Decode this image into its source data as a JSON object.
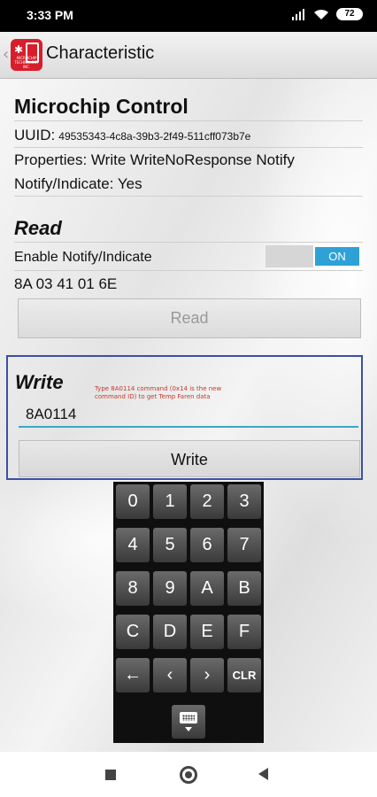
{
  "status": {
    "time": "3:33 PM",
    "battery": "72"
  },
  "appbar": {
    "title": "Characteristic"
  },
  "details": {
    "title": "Microchip Control",
    "uuid_label": "UUID:",
    "uuid_value": "49535343-4c8a-39b3-2f49-511cff073b7e",
    "properties": "Properties: Write WriteNoResponse Notify",
    "notify": "Notify/Indicate: Yes"
  },
  "read": {
    "heading": "Read",
    "enable_label": "Enable Notify/Indicate",
    "toggle_label": "ON",
    "value": "8A 03 41 01 6E",
    "button_label": "Read"
  },
  "write": {
    "heading": "Write",
    "annotation": "Type 8A0114 command (0x14 is the new command ID) to get Temp Faren data",
    "input_value": "8A0114",
    "button_label": "Write"
  },
  "keypad": {
    "rows": [
      [
        "0",
        "1",
        "2",
        "3"
      ],
      [
        "4",
        "5",
        "6",
        "7"
      ],
      [
        "8",
        "9",
        "A",
        "B"
      ],
      [
        "C",
        "D",
        "E",
        "F"
      ],
      [
        "←",
        "‹",
        "›",
        "CLR"
      ]
    ]
  },
  "colors": {
    "accent": "#2ea2d7",
    "annotation_box": "#3b4fa6",
    "annotation_text": "#c0392b",
    "logo": "#d81e2a"
  }
}
